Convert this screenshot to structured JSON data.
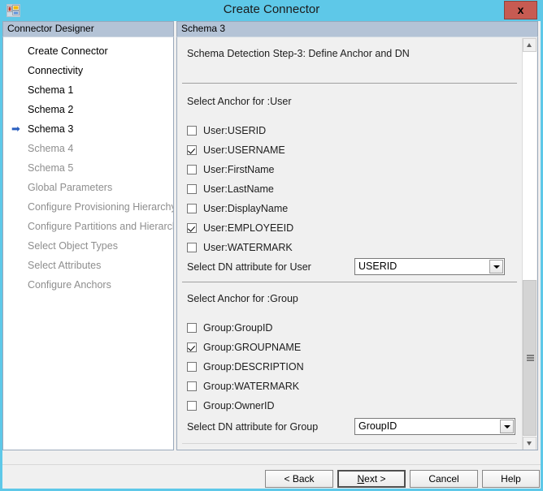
{
  "window": {
    "title": "Create Connector",
    "icon": "app-window-icon",
    "close_label": "x",
    "accent_color": "#5ec8e8",
    "close_color": "#c75b52"
  },
  "sidebar": {
    "header": "Connector Designer",
    "active_marker": "➡",
    "items": [
      {
        "label": "Create Connector",
        "state": "enabled"
      },
      {
        "label": "Connectivity",
        "state": "enabled"
      },
      {
        "label": "Schema 1",
        "state": "enabled"
      },
      {
        "label": "Schema 2",
        "state": "enabled"
      },
      {
        "label": "Schema 3",
        "state": "active"
      },
      {
        "label": "Schema 4",
        "state": "disabled"
      },
      {
        "label": "Schema 5",
        "state": "disabled"
      },
      {
        "label": "Global Parameters",
        "state": "disabled"
      },
      {
        "label": "Configure Provisioning Hierarchy",
        "state": "disabled"
      },
      {
        "label": "Configure Partitions and Hierarchies",
        "state": "disabled"
      },
      {
        "label": "Select Object Types",
        "state": "disabled"
      },
      {
        "label": "Select Attributes",
        "state": "disabled"
      },
      {
        "label": "Configure Anchors",
        "state": "disabled"
      }
    ]
  },
  "main": {
    "header": "Schema 3",
    "step_title": "Schema Detection Step-3: Define Anchor and DN",
    "user_section": {
      "label": "Select Anchor for :User",
      "checkboxes": [
        {
          "label": "User:USERID",
          "checked": false
        },
        {
          "label": "User:USERNAME",
          "checked": true
        },
        {
          "label": "User:FirstName",
          "checked": false
        },
        {
          "label": "User:LastName",
          "checked": false
        },
        {
          "label": "User:DisplayName",
          "checked": false
        },
        {
          "label": "User:EMPLOYEEID",
          "checked": true
        },
        {
          "label": "User:WATERMARK",
          "checked": false
        }
      ],
      "dn_label": "Select DN attribute for User",
      "dn_value": "USERID"
    },
    "group_section": {
      "label": "Select Anchor for :Group",
      "checkboxes": [
        {
          "label": "Group:GroupID",
          "checked": false
        },
        {
          "label": "Group:GROUPNAME",
          "checked": true
        },
        {
          "label": "Group:DESCRIPTION",
          "checked": false
        },
        {
          "label": "Group:WATERMARK",
          "checked": false
        },
        {
          "label": "Group:OwnerID",
          "checked": false
        }
      ],
      "dn_label": "Select DN attribute for Group",
      "dn_value": "GroupID"
    }
  },
  "buttons": {
    "back": "< Back",
    "back_pre": "< ",
    "back_mnemonic": "B",
    "back_post": "ack",
    "next_pre": "",
    "next_mnemonic": "N",
    "next_post": "ext  >",
    "cancel": "Cancel",
    "help": "Help"
  }
}
